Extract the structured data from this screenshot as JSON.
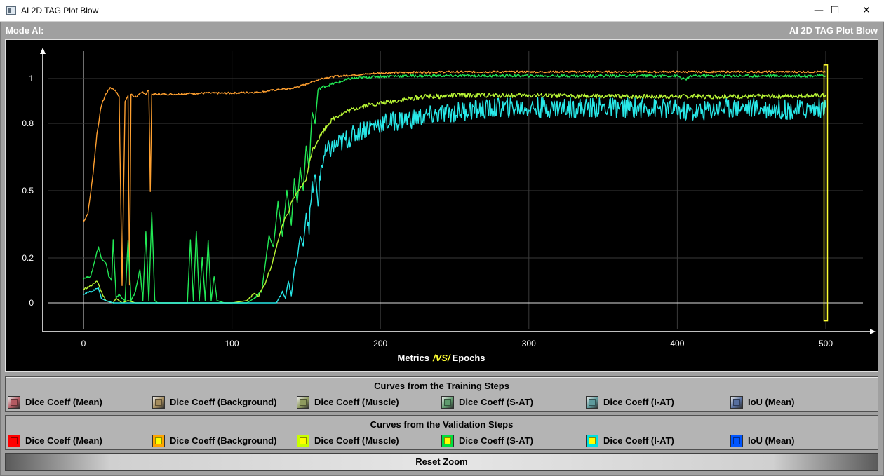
{
  "window": {
    "title": "AI 2D TAG Plot Blow",
    "minimize_glyph": "—",
    "maximize_glyph": "☐",
    "close_glyph": "✕"
  },
  "header": {
    "mode_label": "Mode AI:",
    "title_right": "AI 2D TAG Plot Blow"
  },
  "training": {
    "title": "Curves from the Training Steps",
    "items": [
      {
        "label": "Dice Coeff (Mean)",
        "color": "#b35a62",
        "icon": "red-swatch-icon"
      },
      {
        "label": "Dice Coeff (Background)",
        "color": "#a58d5e",
        "icon": "tan-swatch-icon"
      },
      {
        "label": "Dice Coeff (Muscle)",
        "color": "#8e9a5e",
        "icon": "olive-swatch-icon"
      },
      {
        "label": "Dice Coeff (S-AT)",
        "color": "#5e9a6d",
        "icon": "green-swatch-icon"
      },
      {
        "label": "Dice Coeff (I-AT)",
        "color": "#5e9a9c",
        "icon": "teal-swatch-icon"
      },
      {
        "label": "IoU (Mean)",
        "color": "#566e9e",
        "icon": "blue-swatch-icon"
      }
    ]
  },
  "validation": {
    "title": "Curves from the Validation Steps",
    "items": [
      {
        "label": "Dice Coeff (Mean)",
        "color": "#ff0000",
        "inner": "#ff0000",
        "icon": "red-swatch-icon"
      },
      {
        "label": "Dice Coeff (Background)",
        "color": "#ffa500",
        "inner": "#ffff00",
        "icon": "orange-swatch-icon"
      },
      {
        "label": "Dice Coeff (Muscle)",
        "color": "#c8ff00",
        "inner": "#ffff00",
        "icon": "yellow-green-swatch-icon"
      },
      {
        "label": "Dice Coeff (S-AT)",
        "color": "#00e040",
        "inner": "#ffff00",
        "icon": "green-swatch-icon"
      },
      {
        "label": "Dice Coeff (I-AT)",
        "color": "#00e0e0",
        "inner": "#ffff00",
        "icon": "cyan-swatch-icon"
      },
      {
        "label": "IoU (Mean)",
        "color": "#0055ff",
        "inner": "#0055ff",
        "icon": "blue-swatch-icon"
      }
    ]
  },
  "reset_zoom": "Reset Zoom",
  "chart_data": {
    "type": "line",
    "xlabel_prefix": "Metrics",
    "xlabel_vs": "/VS/",
    "xlabel_suffix": "Epochs",
    "xlim": [
      -28,
      527
    ],
    "ylim": [
      -0.1,
      1.1
    ],
    "x_ticks": [
      0,
      100,
      200,
      300,
      400,
      500
    ],
    "y_ticks": [
      0,
      0.2,
      0.5,
      0.8,
      1
    ],
    "y_tick_labels": [
      "0",
      "0.2",
      "0.5",
      "0.8",
      "1"
    ],
    "grid": true,
    "background": "#000000",
    "marker": {
      "x": 500,
      "color": "#ffff33",
      "y_range": [
        -0.08,
        1.06
      ]
    },
    "series": [
      {
        "color": "#ffa030",
        "x": [
          0,
          3,
          6,
          9,
          12,
          15,
          18,
          21,
          24,
          25,
          26,
          28,
          30,
          31,
          32,
          34,
          36,
          38,
          40,
          42,
          44,
          45,
          46,
          48,
          50,
          60,
          80,
          100,
          120,
          130,
          140,
          150,
          160,
          170,
          180,
          200,
          220,
          250,
          300,
          350,
          400,
          450,
          500
        ],
        "y": [
          0.36,
          0.4,
          0.55,
          0.75,
          0.88,
          0.93,
          0.96,
          0.95,
          0.92,
          0.5,
          0.08,
          0.9,
          0.92,
          0.08,
          0.93,
          0.92,
          0.92,
          0.93,
          0.94,
          0.93,
          0.95,
          0.5,
          0.93,
          0.93,
          0.93,
          0.93,
          0.935,
          0.935,
          0.94,
          0.95,
          0.955,
          0.975,
          1.0,
          1.01,
          1.015,
          1.025,
          1.028,
          1.03,
          1.03,
          1.03,
          1.03,
          1.03,
          1.03
        ]
      },
      {
        "color": "#22e855",
        "x": [
          0,
          5,
          8,
          10,
          12,
          15,
          17,
          19,
          20,
          22,
          24,
          26,
          28,
          30,
          32,
          35,
          38,
          40,
          42,
          44,
          46,
          48,
          50,
          60,
          70,
          72,
          74,
          76,
          78,
          80,
          82,
          84,
          86,
          88,
          90,
          95,
          100,
          105,
          110,
          115,
          120,
          125,
          128,
          131,
          134,
          137,
          140,
          142,
          144,
          146,
          148,
          150,
          152,
          154,
          156,
          158,
          160,
          165,
          170,
          180,
          190,
          200,
          220,
          250,
          300,
          350,
          400,
          405,
          410,
          415,
          420,
          450,
          500
        ],
        "y": [
          0.11,
          0.12,
          0.2,
          0.25,
          0.2,
          0.18,
          0.12,
          0.1,
          0.28,
          0.02,
          0.04,
          0.02,
          0.01,
          0.28,
          0.01,
          0.05,
          0.15,
          0.01,
          0.32,
          0.01,
          0.4,
          0.01,
          0.0,
          0.0,
          0.0,
          0.28,
          0.01,
          0.32,
          0.01,
          0.2,
          0.01,
          0.28,
          0.01,
          0.12,
          0.01,
          0.0,
          0.0,
          0.0,
          0.0,
          0.02,
          0.05,
          0.3,
          0.25,
          0.45,
          0.3,
          0.5,
          0.35,
          0.55,
          0.45,
          0.6,
          0.5,
          0.7,
          0.6,
          0.85,
          0.8,
          0.95,
          0.96,
          0.97,
          0.98,
          1.0,
          1.005,
          1.01,
          1.012,
          1.012,
          1.012,
          1.012,
          1.012,
          0.995,
          1.012,
          1.012,
          1.012,
          1.012,
          1.012
        ]
      },
      {
        "color": "#b8f535",
        "x": [
          0,
          3,
          6,
          9,
          12,
          15,
          20,
          22,
          26,
          30,
          35,
          40,
          60,
          80,
          100,
          110,
          115,
          118,
          120,
          122,
          124,
          126,
          128,
          130,
          132,
          134,
          136,
          138,
          140,
          145,
          150,
          152,
          154,
          156,
          158,
          160,
          165,
          170,
          180,
          190,
          200,
          210,
          220,
          230,
          240,
          250,
          300,
          350,
          400,
          450,
          500
        ],
        "y": [
          0.06,
          0.07,
          0.08,
          0.1,
          0.05,
          0.01,
          0.0,
          0.02,
          0.0,
          0.01,
          0.0,
          0.0,
          0.0,
          0.0,
          0.0,
          0.01,
          0.04,
          0.03,
          0.06,
          0.08,
          0.12,
          0.15,
          0.2,
          0.25,
          0.3,
          0.35,
          0.38,
          0.4,
          0.45,
          0.5,
          0.55,
          0.62,
          0.68,
          0.7,
          0.73,
          0.75,
          0.8,
          0.83,
          0.86,
          0.88,
          0.89,
          0.9,
          0.91,
          0.92,
          0.92,
          0.925,
          0.925,
          0.92,
          0.92,
          0.92,
          0.925
        ]
      },
      {
        "color": "#28e8e8",
        "x": [
          0,
          5,
          8,
          10,
          12,
          15,
          20,
          30,
          60,
          90,
          120,
          130,
          134,
          136,
          138,
          140,
          142,
          144,
          146,
          148,
          150,
          152,
          154,
          156,
          158,
          160,
          162,
          165,
          170,
          175,
          180,
          185,
          190,
          200,
          210,
          220,
          230,
          240,
          250,
          260,
          270,
          280,
          300,
          320,
          350,
          380,
          400,
          410,
          420,
          430,
          450,
          480,
          500
        ],
        "y": [
          0.04,
          0.05,
          0.06,
          0.07,
          0.02,
          0.01,
          0.0,
          0.0,
          0.0,
          0.0,
          0.0,
          0.0,
          0.05,
          0.02,
          0.1,
          0.03,
          0.15,
          0.2,
          0.3,
          0.25,
          0.4,
          0.35,
          0.5,
          0.55,
          0.45,
          0.6,
          0.65,
          0.68,
          0.7,
          0.72,
          0.74,
          0.76,
          0.78,
          0.8,
          0.81,
          0.82,
          0.83,
          0.84,
          0.85,
          0.86,
          0.86,
          0.87,
          0.87,
          0.87,
          0.87,
          0.87,
          0.86,
          0.85,
          0.86,
          0.87,
          0.87,
          0.86,
          0.87
        ]
      }
    ]
  }
}
